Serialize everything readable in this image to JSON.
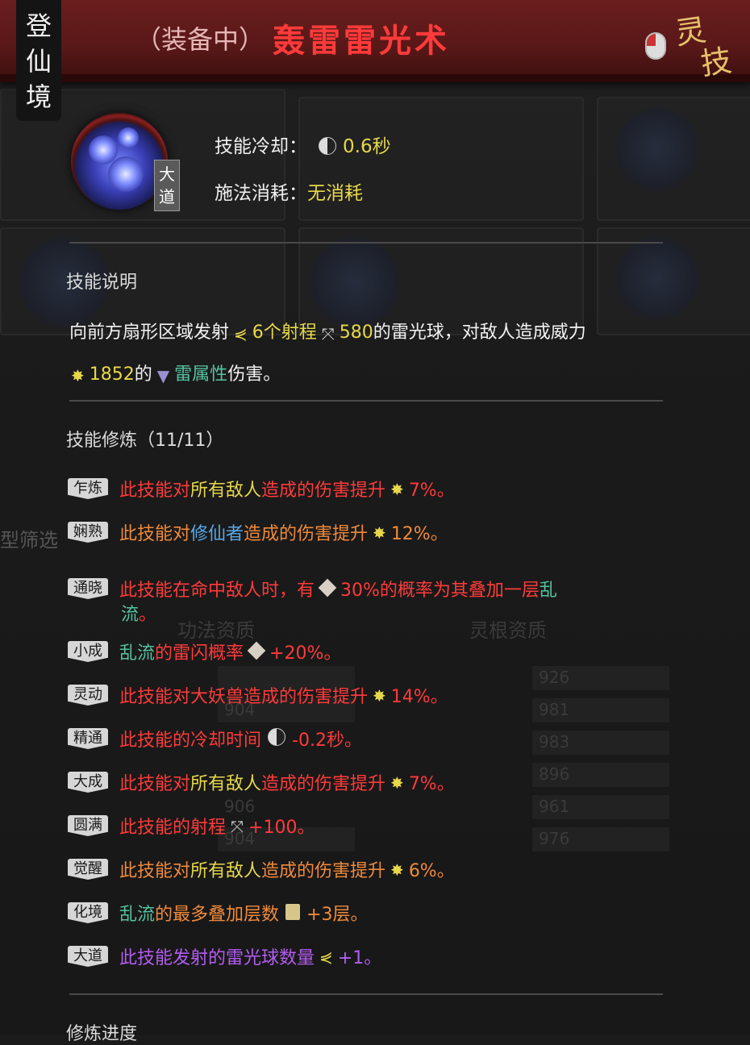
{
  "header": {
    "realm": [
      "登",
      "仙",
      "境"
    ],
    "equip_tag": "（装备中）",
    "skill_name": "轰雷雷光术",
    "corner_label": [
      "灵",
      "技"
    ]
  },
  "skill": {
    "badge": [
      "大",
      "道"
    ],
    "cooldown_label": "技能冷却：",
    "cooldown_value": "0.6秒",
    "cost_label": "施法消耗：",
    "cost_value": "无消耗"
  },
  "description": {
    "title": "技能说明",
    "line1": [
      "向前方扇形区域发射",
      "6个射程",
      "580",
      "的雷光球，对敌人造成威力"
    ],
    "line2": [
      "1852",
      "的",
      "雷属性",
      "伤害。"
    ]
  },
  "cultivation": {
    "title": "技能修炼（11/11）",
    "tiers": [
      {
        "label": "乍炼",
        "parts": [
          "此技能对",
          "所有敌人",
          "造成的伤害提升",
          "7%。"
        ]
      },
      {
        "label": "娴熟",
        "parts": [
          "此技能对",
          "修仙者",
          "造成的伤害提升",
          "12%。"
        ]
      },
      {
        "label": "通晓",
        "parts": [
          "此技能在命中敌人时，有",
          "30%的概率为其叠加一层",
          "乱",
          "流",
          "。"
        ]
      },
      {
        "label": "小成",
        "parts": [
          "乱流",
          "的雷闪概率",
          "+20%。"
        ]
      },
      {
        "label": "灵动",
        "parts": [
          "此技能对大妖兽造成的伤害提升",
          "14%。"
        ]
      },
      {
        "label": "精通",
        "parts": [
          "此技能的冷却时间",
          "-0.2秒。"
        ]
      },
      {
        "label": "大成",
        "parts": [
          "此技能对",
          "所有敌人",
          "造成的伤害提升",
          "7%。"
        ]
      },
      {
        "label": "圆满",
        "parts": [
          "此技能的射程",
          "+100。"
        ]
      },
      {
        "label": "觉醒",
        "parts": [
          "此技能对",
          "所有敌人",
          "造成的伤害提升",
          "6%。"
        ]
      },
      {
        "label": "化境",
        "parts": [
          "乱流",
          "的最多叠加层数",
          "+3层。"
        ]
      },
      {
        "label": "大道",
        "parts": [
          "此技能发射的雷光球数量",
          "+1。"
        ]
      }
    ],
    "progress_title": "修炼进度"
  },
  "background": {
    "labels": [
      "功法资质",
      "灵根资质",
      "型筛选"
    ],
    "values": [
      "926",
      "981",
      "983",
      "896",
      "961",
      "976",
      "904",
      "906",
      "904"
    ]
  },
  "colors": {
    "header_red": "#6a1e1e",
    "skill_name": "#ff3a3a",
    "yellow": "#e7d84a",
    "green": "#56c2a0",
    "blue": "#5aa8e8",
    "red": "#ff3a3a",
    "orange": "#f08a3a",
    "purple": "#b35cf0"
  }
}
